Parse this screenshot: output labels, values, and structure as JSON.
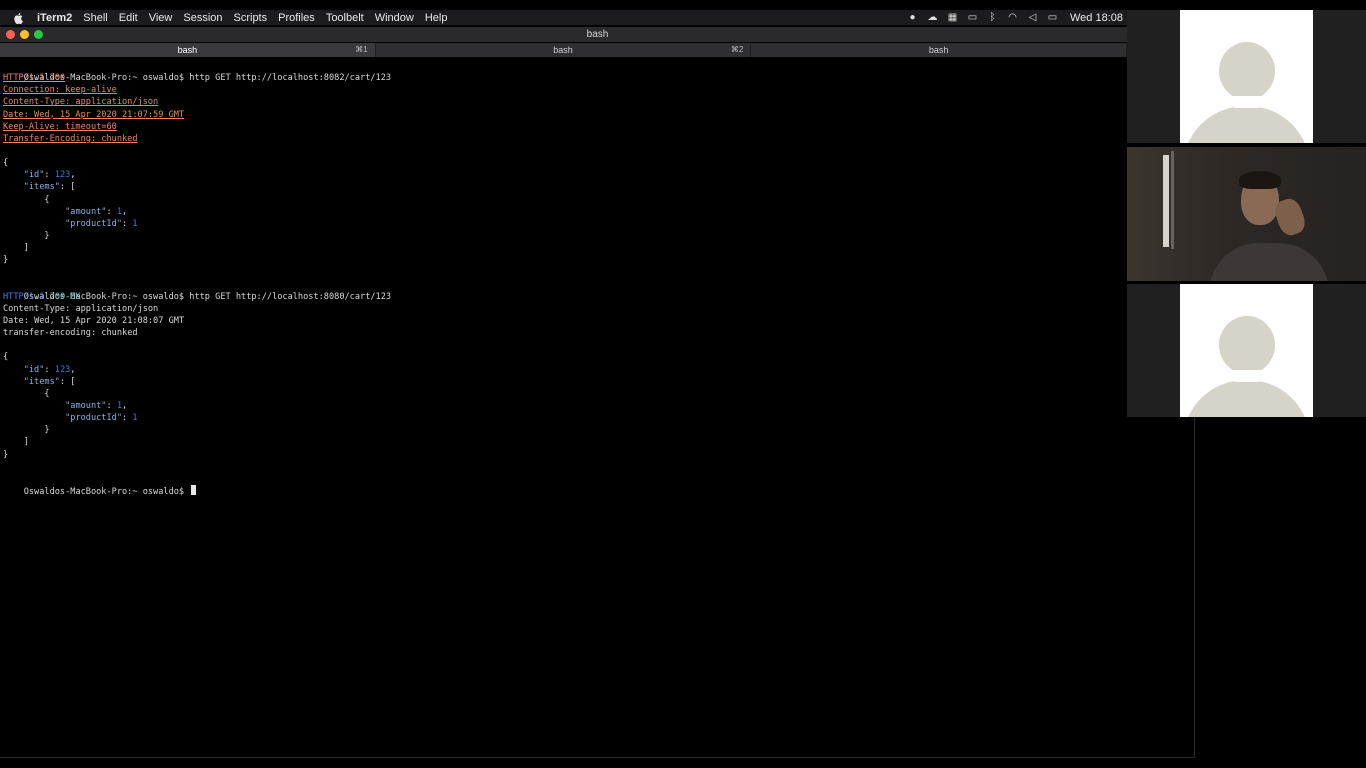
{
  "menubar": {
    "apple_icon": "apple-logo-icon",
    "app_name": "iTerm2",
    "items": [
      "Shell",
      "Edit",
      "View",
      "Session",
      "Scripts",
      "Profiles",
      "Toolbelt",
      "Window",
      "Help"
    ],
    "status_icons": [
      "evernote-icon",
      "creative-cloud-icon",
      "docker-icon",
      "airplay-icon",
      "bluetooth-icon",
      "wifi-icon",
      "volume-icon",
      "battery-icon"
    ],
    "clock": "Wed 18:08"
  },
  "window": {
    "title": "bash"
  },
  "tabs": [
    {
      "label": "bash",
      "shortcut": "⌘1",
      "active": true
    },
    {
      "label": "bash",
      "shortcut": "⌘2",
      "active": false
    },
    {
      "label": "bash",
      "shortcut": "",
      "active": false
    }
  ],
  "terminal": {
    "prompt": "Oswaldos-MacBook-Pro:~ oswaldo$",
    "cmd1": "http GET http://localhost:8082/cart/123",
    "resp1": {
      "status": "HTTP/1.1 200",
      "headers": [
        "Connection: keep-alive",
        "Content-Type: application/json",
        "Date: Wed, 15 Apr 2020 21:07:59 GMT",
        "Keep-Alive: timeout=60",
        "Transfer-Encoding: chunked"
      ]
    },
    "cmd2": "http GET http://localhost:8080/cart/123",
    "resp2": {
      "status_proto": "HTTP/1.1",
      "status_code": "200",
      "status_text": "OK",
      "headers": [
        {
          "name": "Content-Type:",
          "value": "application/json"
        },
        {
          "name": "Date:",
          "value": "Wed, 15 Apr 2020 21:08:07 GMT"
        },
        {
          "name": "transfer-encoding:",
          "value": "chunked"
        }
      ]
    },
    "json_body": {
      "open": "{",
      "id_key": "\"id\"",
      "id_val": "123",
      "items_key": "\"items\"",
      "items_open": "[",
      "obj_open": "{",
      "amount_key": "\"amount\"",
      "amount_val": "1",
      "product_key": "\"productId\"",
      "product_val": "1",
      "obj_close": "}",
      "items_close": "]",
      "close": "}"
    }
  },
  "video_panels": [
    {
      "type": "avatar-placeholder"
    },
    {
      "type": "camera-feed"
    },
    {
      "type": "avatar-placeholder"
    }
  ]
}
